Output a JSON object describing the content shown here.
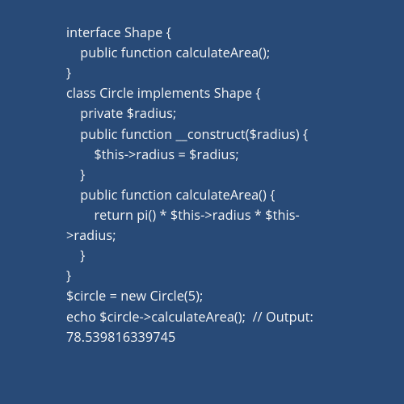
{
  "code": {
    "line1": "interface Shape {",
    "line2": "    public function calculateArea();",
    "line3": "}",
    "line4": "",
    "line5": "class Circle implements Shape {",
    "line6": "    private $radius;",
    "line7": "",
    "line8": "    public function __construct($radius) {",
    "line9": "        $this->radius = $radius;",
    "line10": "    }",
    "line11": "",
    "line12": "    public function calculateArea() {",
    "line13": "        return pi() * $this->radius * $this->radius;",
    "line14": "    }",
    "line15": "}",
    "line16": "",
    "line17": "$circle = new Circle(5);",
    "line18": "echo $circle->calculateArea();  // Output: 78.539816339745"
  }
}
